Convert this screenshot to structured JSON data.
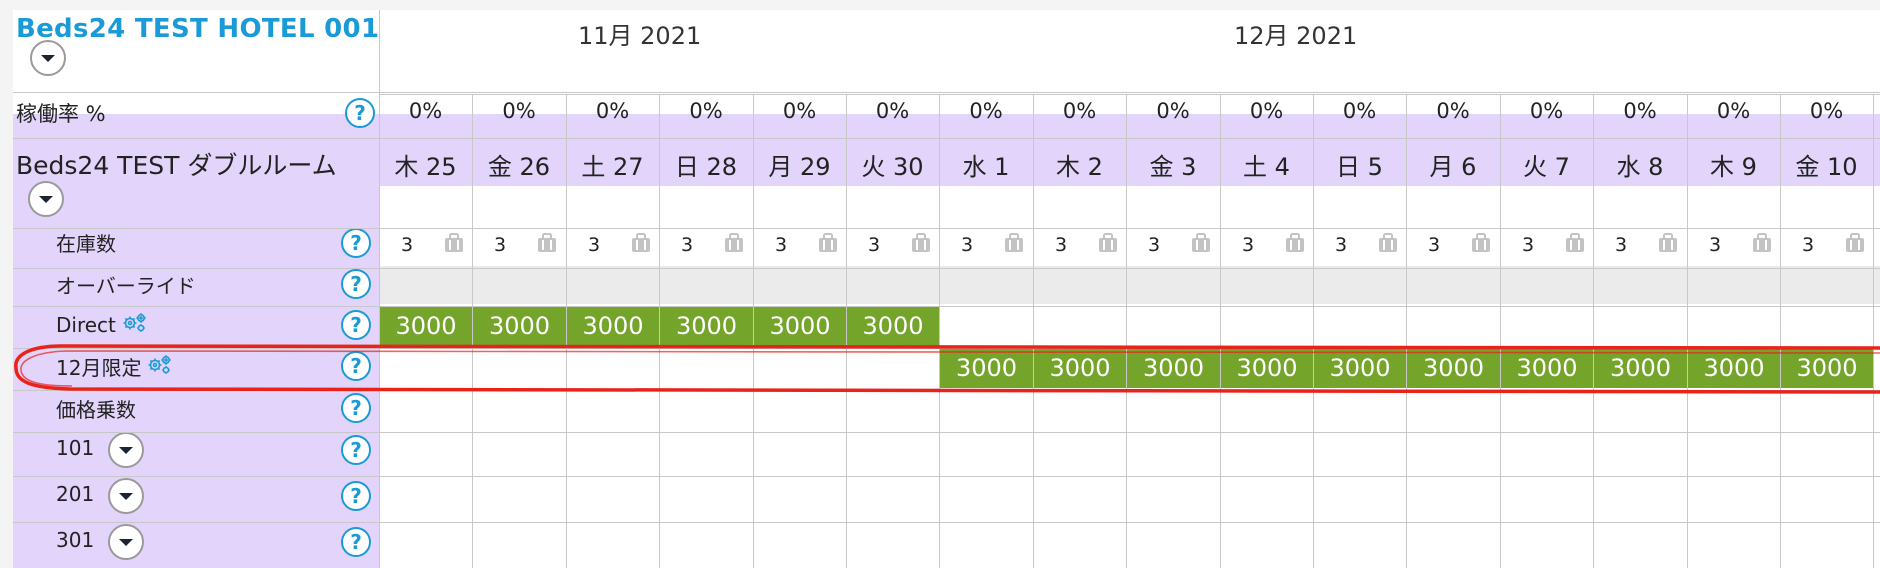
{
  "hotel": {
    "title": "Beds24 TEST HOTEL 001"
  },
  "months": [
    "11月 2021",
    "12月 2021"
  ],
  "occupancy": {
    "label": "稼働率 %",
    "values": [
      "0%",
      "0%",
      "0%",
      "0%",
      "0%",
      "0%",
      "0%",
      "0%",
      "0%",
      "0%",
      "0%",
      "0%",
      "0%",
      "0%",
      "0%",
      "0%"
    ]
  },
  "room": {
    "title": "Beds24 TEST ダブルルーム"
  },
  "days": [
    "木 25",
    "金 26",
    "土 27",
    "日 28",
    "月 29",
    "火 30",
    "水 1",
    "木 2",
    "金 3",
    "土 4",
    "日 5",
    "月 6",
    "火 7",
    "水 8",
    "木 9",
    "金 10"
  ],
  "rows": {
    "inventory": "在庫数",
    "override": "オーバーライド",
    "direct": "Direct",
    "december": "12月限定",
    "multiplier": "価格乗数",
    "unit101": "101",
    "unit201": "201",
    "unit301": "301"
  },
  "inventory_values": [
    "3",
    "3",
    "3",
    "3",
    "3",
    "3",
    "3",
    "3",
    "3",
    "3",
    "3",
    "3",
    "3",
    "3",
    "3",
    "3"
  ],
  "direct_prices": [
    "3000",
    "3000",
    "3000",
    "3000",
    "3000",
    "3000",
    "",
    "",
    "",
    "",
    "",
    "",
    "",
    "",
    "",
    ""
  ],
  "december_prices": [
    "",
    "",
    "",
    "",
    "",
    "",
    "3000",
    "3000",
    "3000",
    "3000",
    "3000",
    "3000",
    "3000",
    "3000",
    "3000",
    "3000"
  ],
  "help_symbol": "?",
  "colors": {
    "title": "#1a9ad6",
    "lavender": "#e2d4fa",
    "price_green": "#74a42a",
    "highlight_red": "#e8231a",
    "override_gray": "#ebebeb"
  },
  "icons": {
    "dropdown": "chevron-down-icon",
    "help": "question-icon",
    "gear": "gear-icon",
    "bag": "luggage-icon"
  }
}
